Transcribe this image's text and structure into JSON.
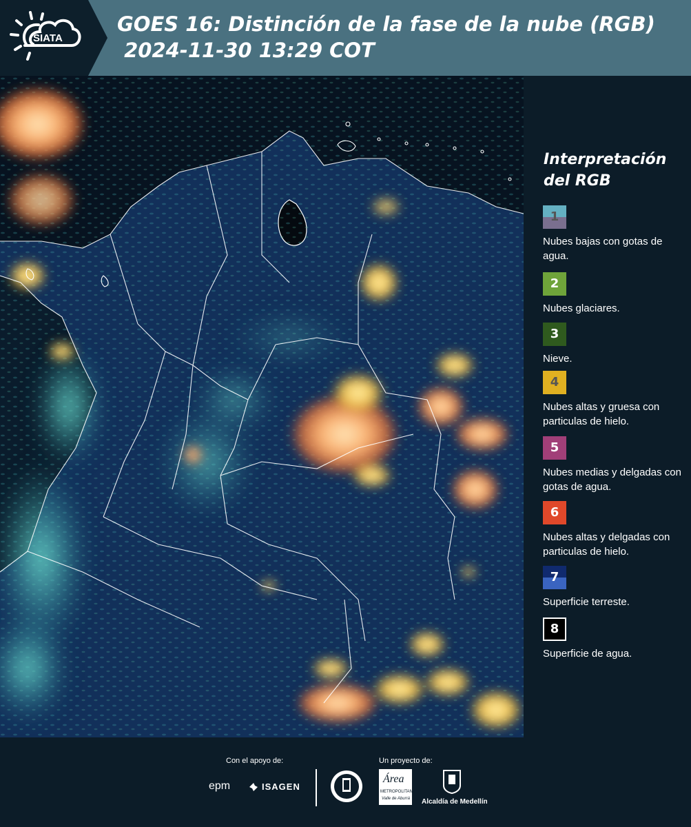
{
  "header": {
    "logo_text": "SIATA",
    "title_line1": "GOES 16: Distinción de la fase de la nube (RGB)",
    "title_line2": " 2024-11-30 13:29 COT"
  },
  "legend": {
    "title": "Interpretación del RGB",
    "items": [
      {
        "num": "1",
        "label": "Nubes bajas con gotas de agua.",
        "color_top": "#64b0c2",
        "color_bottom": "#7a6f8f",
        "num_color": "#555555"
      },
      {
        "num": "2",
        "label": "Nubes glaciares.",
        "color_top": "#6fa43a",
        "color_bottom": "#6fa43a",
        "num_color": "#ffffff"
      },
      {
        "num": "3",
        "label": "Nieve.",
        "color_top": "#2f5a1e",
        "color_bottom": "#2f5a1e",
        "num_color": "#ffffff"
      },
      {
        "num": "4",
        "label": "Nubes altas y gruesa con particulas de hielo.",
        "color_top": "#e0b021",
        "color_bottom": "#e0b021",
        "num_color": "#555555"
      },
      {
        "num": "5",
        "label": "Nubes medias y delgadas con gotas de agua.",
        "color_top": "#a13f78",
        "color_bottom": "#a13f78",
        "num_color": "#ffffff"
      },
      {
        "num": "6",
        "label": "Nubes altas y delgadas con particulas de hielo.",
        "color_top": "#e0482a",
        "color_bottom": "#e0482a",
        "num_color": "#ffffff"
      },
      {
        "num": "7",
        "label": "Superficie terreste.",
        "color_top": "#102a6e",
        "color_bottom": "#3a64c0",
        "num_color": "#ffffff"
      },
      {
        "num": "8",
        "label": "Superficie de agua.",
        "color_top": "#000000",
        "color_bottom": "#000000",
        "num_color": "#ffffff"
      }
    ]
  },
  "footer": {
    "support_label": "Con el apoyo de:",
    "project_label": "Un proyecto de:",
    "sponsor1": "epm",
    "sponsor2": "ISAGEN",
    "partner_area": "Área",
    "partner_area_sub": "METROPOLITANA",
    "partner_area_sub2": "Valle de Aburrá",
    "partner_alcaldia": "Alcaldía de Medellín"
  }
}
